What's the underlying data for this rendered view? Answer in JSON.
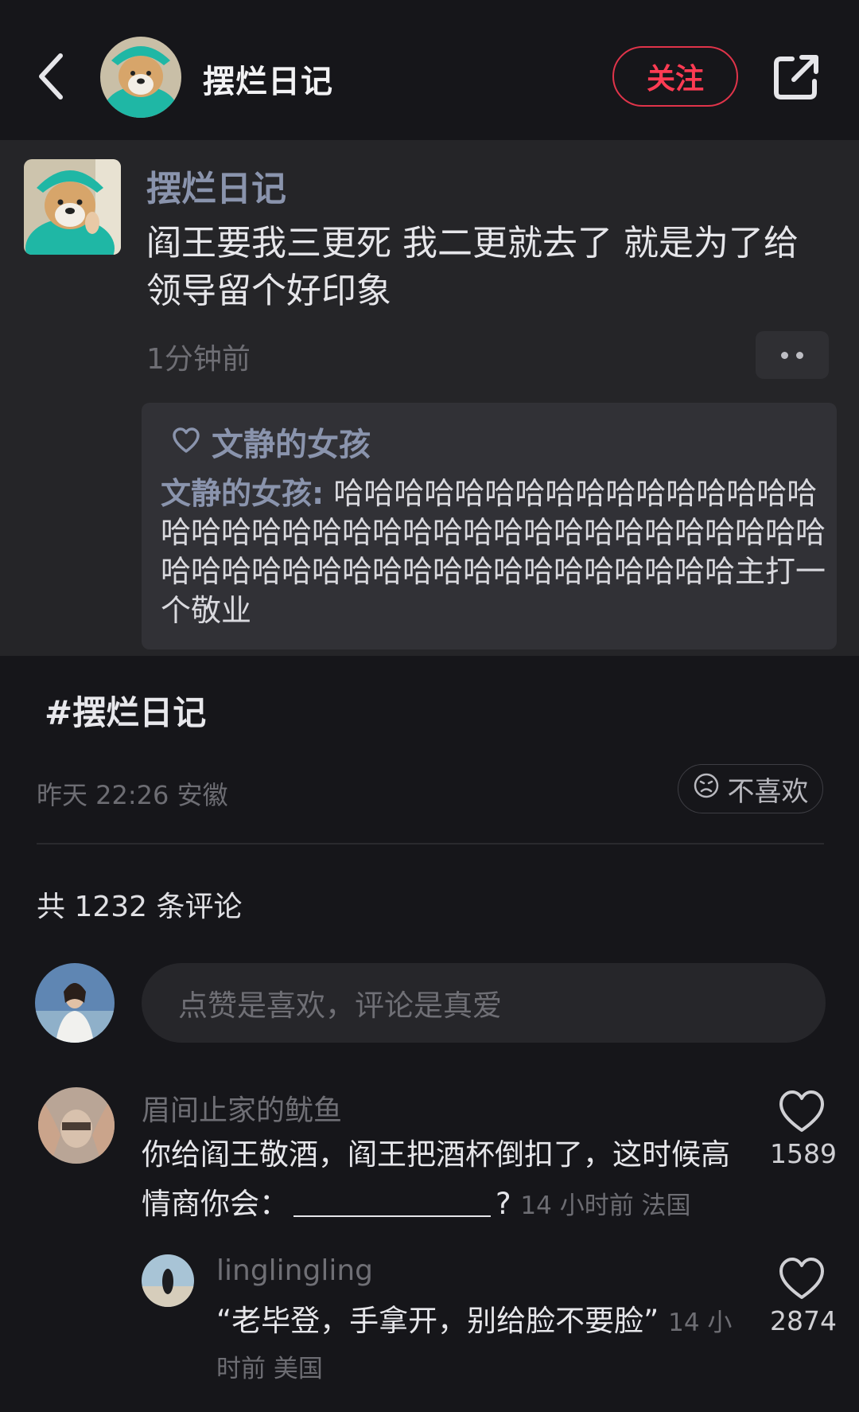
{
  "header": {
    "title": "摆烂日记",
    "follow_label": "关注"
  },
  "post": {
    "author": "摆烂日记",
    "text": "阎王要我三更死  我二更就去了  就是为了给领导留个好印象",
    "time": "1分钟前",
    "quote": {
      "title": "文静的女孩",
      "name": "文静的女孩:",
      "text": " 哈哈哈哈哈哈哈哈哈哈哈哈哈哈哈哈哈哈哈哈哈哈哈哈哈哈哈哈哈哈哈哈哈哈哈哈哈哈哈哈哈哈哈哈哈哈哈哈哈哈哈哈哈哈哈哈哈主打一个敬业"
    }
  },
  "hashtag": "#摆烂日记",
  "post_meta": "昨天 22:26 安徽",
  "dislike_label": "不喜欢",
  "comments_count": "共 1232 条评论",
  "comment_input_placeholder": "点赞是喜欢，评论是真爱",
  "comments": [
    {
      "user": "眉间止家的鱿鱼",
      "text_before": "你给阎王敬酒，阎王把酒杯倒扣了，这时候高情商你会：",
      "text_after": "?",
      "meta": "14 小时前  法国",
      "likes": "1589"
    },
    {
      "user": "linglingling",
      "text": "“老毕登，手拿开，别给脸不要脸”",
      "meta": "14 小时前  美国",
      "likes": "2874"
    }
  ],
  "colors": {
    "background": "#16161a",
    "card": "#252528",
    "accent": "#ff3b53",
    "link": "#8a94ad"
  }
}
